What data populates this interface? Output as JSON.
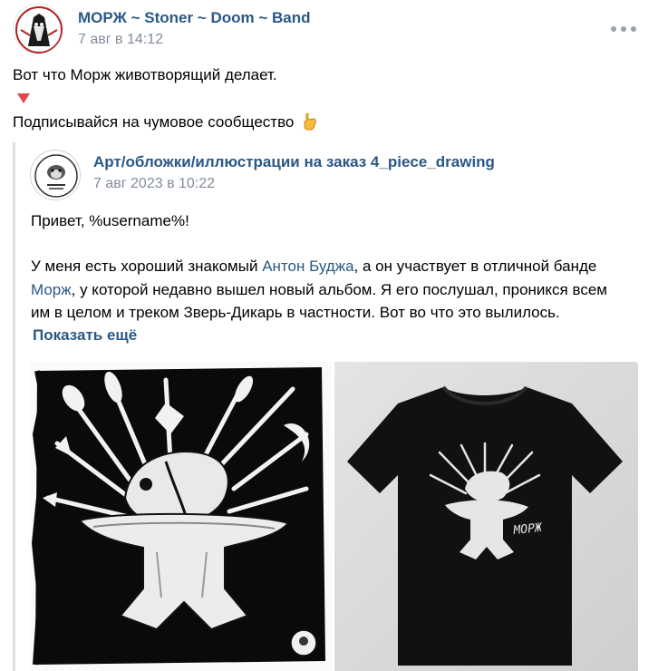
{
  "post": {
    "author": "МОРЖ ~ Stoner ~ Doom ~ Band",
    "date": "7 авг в 14:12",
    "text_line1": "Вот что Морж животворящий делает.",
    "text_line2": "Подписывайся на чумовое сообщество",
    "triangle_icon": "red-down-triangle",
    "hand_icon": "pointing-down-hand",
    "more_icon": "three-dots"
  },
  "repost": {
    "author": "Арт/обложки/иллюстрации на заказ 4_piece_drawing",
    "date": "7 авг 2023 в 10:22",
    "greeting": "Привет, %username%!",
    "para1_line1_a": "У меня есть хороший знакомый ",
    "para1_line1_link": "Антон Буджа",
    "para1_line1_b": ", а он участвует в отличной банде",
    "para1_line2_link": "Морж",
    "para1_line2_b": ", у которой недавно вышел новый альбом. Я его послушал, проникся всем",
    "para1_line3": "им в целом и треком Зверь-Дикарь в частности. Вот во что это вылилось.",
    "show_more": "Показать ещё",
    "shirt_print_text": "МОРЖ"
  },
  "colors": {
    "link": "#2a5885",
    "meta": "#818c99",
    "quote_bar": "#dce1e6",
    "triangle": "#e64646",
    "hand": "#f6b93b"
  }
}
